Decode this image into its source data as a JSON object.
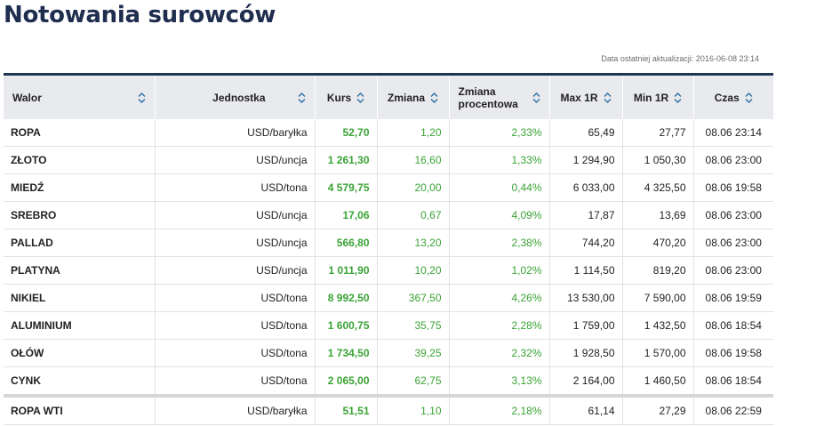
{
  "page": {
    "title": "Notowania surowców",
    "last_update": "Data ostatniej aktualizacji: 2016-06-08 23:14"
  },
  "colors": {
    "title": "#1f2d4f",
    "header_bg": "#e9eaed",
    "header_border": "#1f3552",
    "positive": "#3aa335",
    "sort_icon": "#2a6ea6"
  },
  "icons": {
    "sort": "sort-arrows-icon"
  },
  "table": {
    "headers": {
      "walor": "Walor",
      "jednostka": "Jednostka",
      "kurs": "Kurs",
      "zmiana": "Zmiana",
      "zmiana_proc": "Zmiana procentowa",
      "max1r": "Max 1R",
      "min1r": "Min 1R",
      "czas": "Czas"
    },
    "rows": [
      {
        "walor": "ROPA",
        "jednostka": "USD/baryłka",
        "kurs": "52,70",
        "zmiana": "1,20",
        "zmiana_proc": "2,33%",
        "max1r": "65,49",
        "min1r": "27,77",
        "czas": "08.06 23:14"
      },
      {
        "walor": "ZŁOTO",
        "jednostka": "USD/uncja",
        "kurs": "1 261,30",
        "zmiana": "16,60",
        "zmiana_proc": "1,33%",
        "max1r": "1 294,90",
        "min1r": "1 050,30",
        "czas": "08.06 23:00"
      },
      {
        "walor": "MIEDŹ",
        "jednostka": "USD/tona",
        "kurs": "4 579,75",
        "zmiana": "20,00",
        "zmiana_proc": "0,44%",
        "max1r": "6 033,00",
        "min1r": "4 325,50",
        "czas": "08.06 19:58"
      },
      {
        "walor": "SREBRO",
        "jednostka": "USD/uncja",
        "kurs": "17,06",
        "zmiana": "0,67",
        "zmiana_proc": "4,09%",
        "max1r": "17,87",
        "min1r": "13,69",
        "czas": "08.06 23:00"
      },
      {
        "walor": "PALLAD",
        "jednostka": "USD/uncja",
        "kurs": "566,80",
        "zmiana": "13,20",
        "zmiana_proc": "2,38%",
        "max1r": "744,20",
        "min1r": "470,20",
        "czas": "08.06 23:00"
      },
      {
        "walor": "PLATYNA",
        "jednostka": "USD/uncja",
        "kurs": "1 011,90",
        "zmiana": "10,20",
        "zmiana_proc": "1,02%",
        "max1r": "1 114,50",
        "min1r": "819,20",
        "czas": "08.06 23:00"
      },
      {
        "walor": "NIKIEL",
        "jednostka": "USD/tona",
        "kurs": "8 992,50",
        "zmiana": "367,50",
        "zmiana_proc": "4,26%",
        "max1r": "13 530,00",
        "min1r": "7 590,00",
        "czas": "08.06 19:59"
      },
      {
        "walor": "ALUMINIUM",
        "jednostka": "USD/tona",
        "kurs": "1 600,75",
        "zmiana": "35,75",
        "zmiana_proc": "2,28%",
        "max1r": "1 759,00",
        "min1r": "1 432,50",
        "czas": "08.06 18:54"
      },
      {
        "walor": "OŁÓW",
        "jednostka": "USD/tona",
        "kurs": "1 734,50",
        "zmiana": "39,25",
        "zmiana_proc": "2,32%",
        "max1r": "1 928,50",
        "min1r": "1 570,00",
        "czas": "08.06 19:58"
      },
      {
        "walor": "CYNK",
        "jednostka": "USD/tona",
        "kurs": "2 065,00",
        "zmiana": "62,75",
        "zmiana_proc": "3,13%",
        "max1r": "2 164,00",
        "min1r": "1 460,50",
        "czas": "08.06 18:54"
      },
      {
        "walor": "ROPA WTI",
        "jednostka": "USD/baryłka",
        "kurs": "51,51",
        "zmiana": "1,10",
        "zmiana_proc": "2,18%",
        "max1r": "61,14",
        "min1r": "27,29",
        "czas": "08.06 22:59"
      }
    ]
  }
}
